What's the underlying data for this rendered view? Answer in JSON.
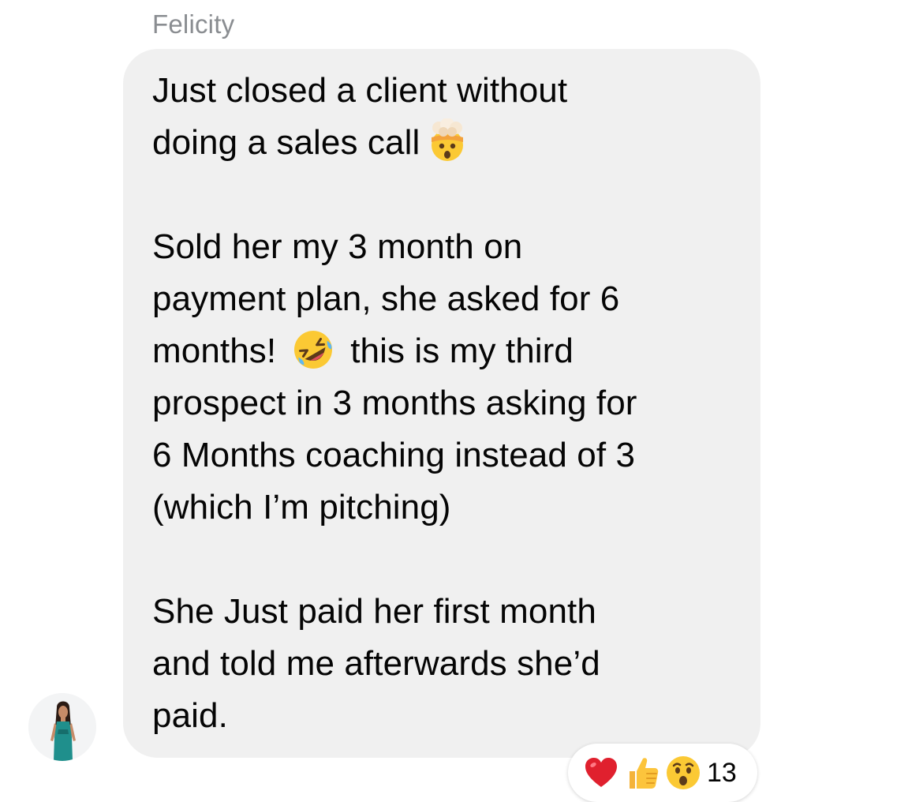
{
  "message": {
    "sender": "Felicity",
    "paragraphs": [
      [
        "Just closed a client without",
        "doing a sales call"
      ],
      [
        "Sold her my 3 month on",
        "payment plan, she asked for 6",
        "months!",
        "this is my third",
        "prospect in 3 months asking for",
        "6 Months coaching instead of 3",
        "(which I’m pitching)"
      ],
      [
        "She Just paid her first month",
        "and told me afterwards she’d",
        "paid."
      ]
    ],
    "inline_emojis": [
      "exploding-head-emoji",
      "rofl-emoji"
    ]
  },
  "reactions": {
    "icons": [
      "heart-icon",
      "thumbs-up-icon",
      "wow-icon"
    ],
    "count": "13"
  },
  "colors": {
    "bubble": "#f0f0f0",
    "sender_name": "#8a8d91",
    "text": "#050505"
  }
}
